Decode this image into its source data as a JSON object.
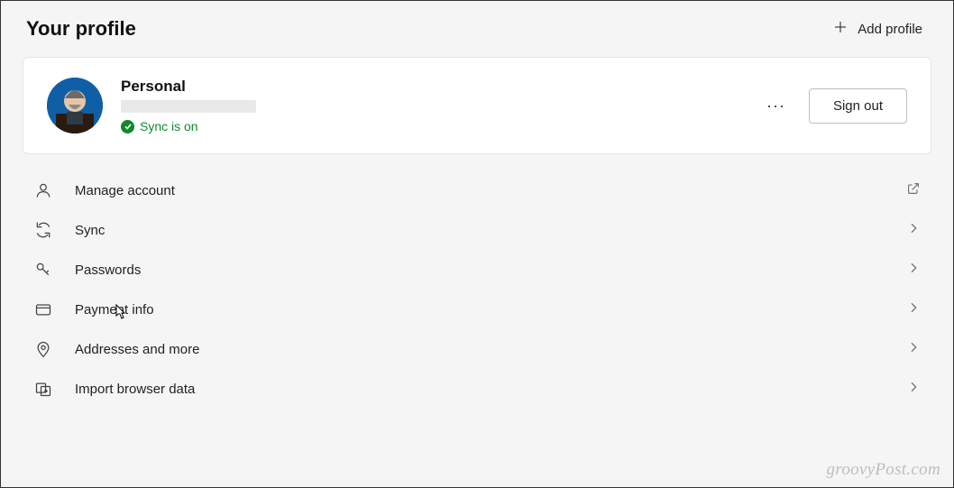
{
  "header": {
    "title": "Your profile",
    "add_profile_label": "Add profile"
  },
  "profile": {
    "name": "Personal",
    "sync_status": "Sync is on",
    "more_label": "···",
    "signout_label": "Sign out"
  },
  "menu": [
    {
      "id": "manage-account",
      "label": "Manage account",
      "action": "external"
    },
    {
      "id": "sync",
      "label": "Sync",
      "action": "chevron"
    },
    {
      "id": "passwords",
      "label": "Passwords",
      "action": "chevron"
    },
    {
      "id": "payment-info",
      "label": "Payment info",
      "action": "chevron"
    },
    {
      "id": "addresses",
      "label": "Addresses and more",
      "action": "chevron"
    },
    {
      "id": "import",
      "label": "Import browser data",
      "action": "chevron"
    }
  ],
  "watermark": "groovyPost.com"
}
